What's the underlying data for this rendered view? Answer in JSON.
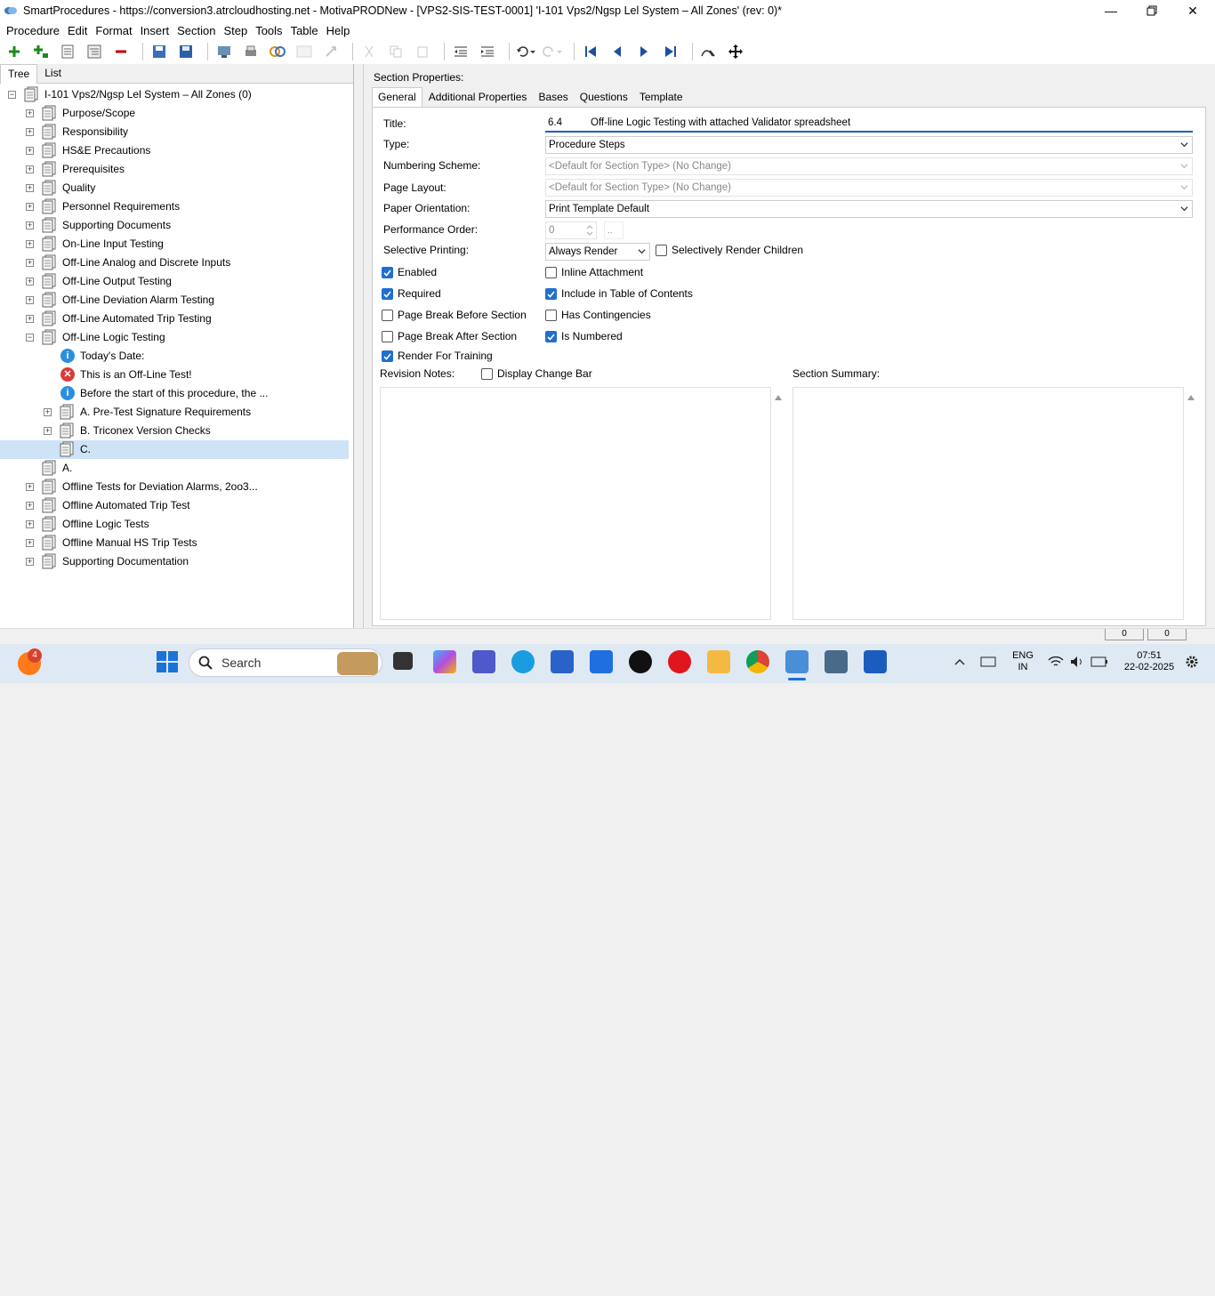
{
  "window": {
    "title": "SmartProcedures - https://conversion3.atrcloudhosting.net - MotivaPRODNew - [VPS2-SIS-TEST-0001] 'I-101 Vps2/Ngsp Lel System – All Zones' (rev: 0)*"
  },
  "menu": [
    "Procedure",
    "Edit",
    "Format",
    "Insert",
    "Section",
    "Step",
    "Tools",
    "Table",
    "Help"
  ],
  "left_tabs": [
    "Tree",
    "List"
  ],
  "tree": {
    "root": "I-101 Vps2/Ngsp Lel System – All Zones (0)",
    "items": [
      "Purpose/Scope",
      "Responsibility",
      "HS&E Precautions",
      "Prerequisites",
      "Quality",
      "Personnel Requirements",
      "Supporting Documents",
      "On-Line Input Testing",
      "Off-Line Analog and Discrete Inputs",
      "Off-Line Output Testing",
      "Off-Line Deviation Alarm Testing",
      "Off-Line Automated Trip Testing",
      "Off-Line Logic Testing"
    ],
    "children": [
      "Today's Date:",
      "This is an Off-Line Test!",
      "Before the start of this procedure, the ...",
      "A. Pre-Test Signature Requirements",
      "B. Triconex Version Checks",
      "C."
    ],
    "after": [
      "A.",
      "Offline Tests for Deviation Alarms, 2oo3...",
      "Offline Automated Trip Test",
      "Offline Logic Tests",
      "Offline Manual HS Trip Tests",
      "Supporting Documentation"
    ]
  },
  "section": {
    "heading": "Section Properties:",
    "tabs": [
      "General",
      "Additional Properties",
      "Bases",
      "Questions",
      "Template"
    ],
    "labels": {
      "title": "Title:",
      "type": "Type:",
      "numbering": "Numbering Scheme:",
      "layout": "Page Layout:",
      "orientation": "Paper Orientation:",
      "perf": "Performance Order:",
      "selective": "Selective Printing:"
    },
    "values": {
      "title_num": "6.4",
      "title_text": "Off-line Logic Testing with attached Validator spreadsheet",
      "type": "Procedure Steps",
      "numbering": "<Default for Section Type> (No Change)",
      "layout": "<Default for Section Type> (No Change)",
      "orientation": "Print Template Default",
      "perf": "0",
      "perf_btn": "..",
      "selective": "Always Render"
    },
    "checks": {
      "selectively_render_children": "Selectively Render Children",
      "enabled": "Enabled",
      "inline_attachment": "Inline Attachment",
      "required": "Required",
      "include_toc": "Include in Table of Contents",
      "page_break_before": "Page Break Before Section",
      "has_contingencies": "Has Contingencies",
      "page_break_after": "Page Break After Section",
      "is_numbered": "Is Numbered",
      "render_training": "Render For Training",
      "display_change_bar": "Display Change Bar"
    },
    "revision_notes": "Revision Notes:",
    "section_summary": "Section Summary:"
  },
  "status": {
    "left": "0",
    "right": "0"
  },
  "taskbar": {
    "search": "Search",
    "badge": "4",
    "lang1": "ENG",
    "lang2": "IN",
    "time": "07:51",
    "date": "22-02-2025"
  }
}
